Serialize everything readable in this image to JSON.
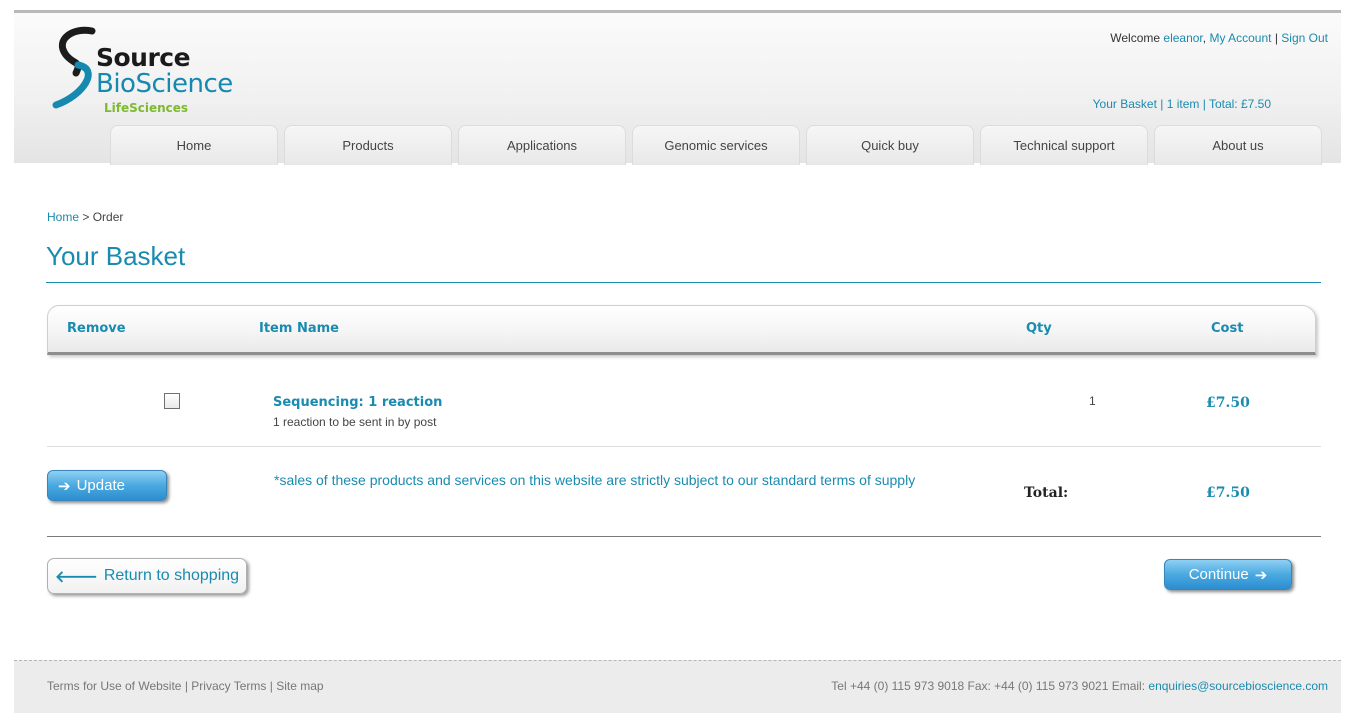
{
  "logo": {
    "line1": "Source",
    "line2": "BioScience",
    "line3": "LifeSciences"
  },
  "account": {
    "welcome_prefix": "Welcome",
    "username": "eleanor",
    "my_account": "My Account",
    "sign_out": "Sign Out"
  },
  "basket_summary": "Your Basket | 1 item | Total: £7.50",
  "nav": [
    "Home",
    "Products",
    "Applications",
    "Genomic services",
    "Quick buy",
    "Technical support",
    "About us"
  ],
  "breadcrumb": {
    "home": "Home",
    "current": "Order"
  },
  "page_title": "Your Basket",
  "table": {
    "headers": {
      "remove": "Remove",
      "item": "Item Name",
      "qty": "Qty",
      "cost": "Cost"
    },
    "rows": [
      {
        "name": "Sequencing: 1 reaction",
        "description": "1 reaction to be sent in by post",
        "qty": "1",
        "cost": "£7.50"
      }
    ]
  },
  "update_button": "Update",
  "terms_text": "*sales of these products and services on this website are strictly subject to our standard terms of supply",
  "total": {
    "label": "Total:",
    "value": "£7.50"
  },
  "return_button": "Return to shopping",
  "continue_button": "Continue",
  "footer": {
    "terms": "Terms for Use of Website",
    "privacy": "Privacy Terms",
    "sitemap": "Site map",
    "contact": "Tel +44 (0) 115 973 9018 Fax: +44 (0) 115 973 9021 Email:",
    "email": "enquiries@sourcebioscience.com"
  },
  "colors": {
    "brand_blue": "#1a8bb0",
    "brand_green": "#7dbb2e",
    "button_blue": "#4aa9e0"
  }
}
